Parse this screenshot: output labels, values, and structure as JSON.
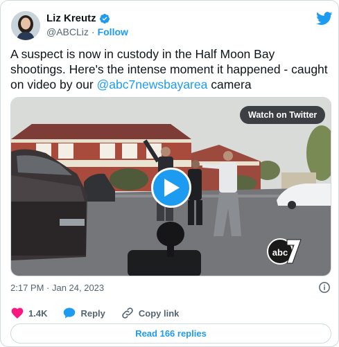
{
  "author": {
    "name": "Liz Kreutz",
    "handle": "@ABCLiz",
    "separator": "·",
    "follow_label": "Follow"
  },
  "tweet": {
    "text_before": "A suspect is now in custody in the Half Moon Bay shootings. Here's the intense moment it happened - caught on video by our ",
    "mention": "@abc7newsbayarea",
    "text_after": " camera"
  },
  "media": {
    "watch_label": "Watch on Twitter",
    "watermark_text": "abc"
  },
  "timestamp": "2:17 PM · Jan 24, 2023",
  "actions": {
    "likes": "1.4K",
    "reply_label": "Reply",
    "copy_link_label": "Copy link"
  },
  "replies_button": "Read 166 replies",
  "colors": {
    "accent": "#1d9bf0",
    "like": "#f91880",
    "text": "#0f1419",
    "muted": "#536471"
  }
}
